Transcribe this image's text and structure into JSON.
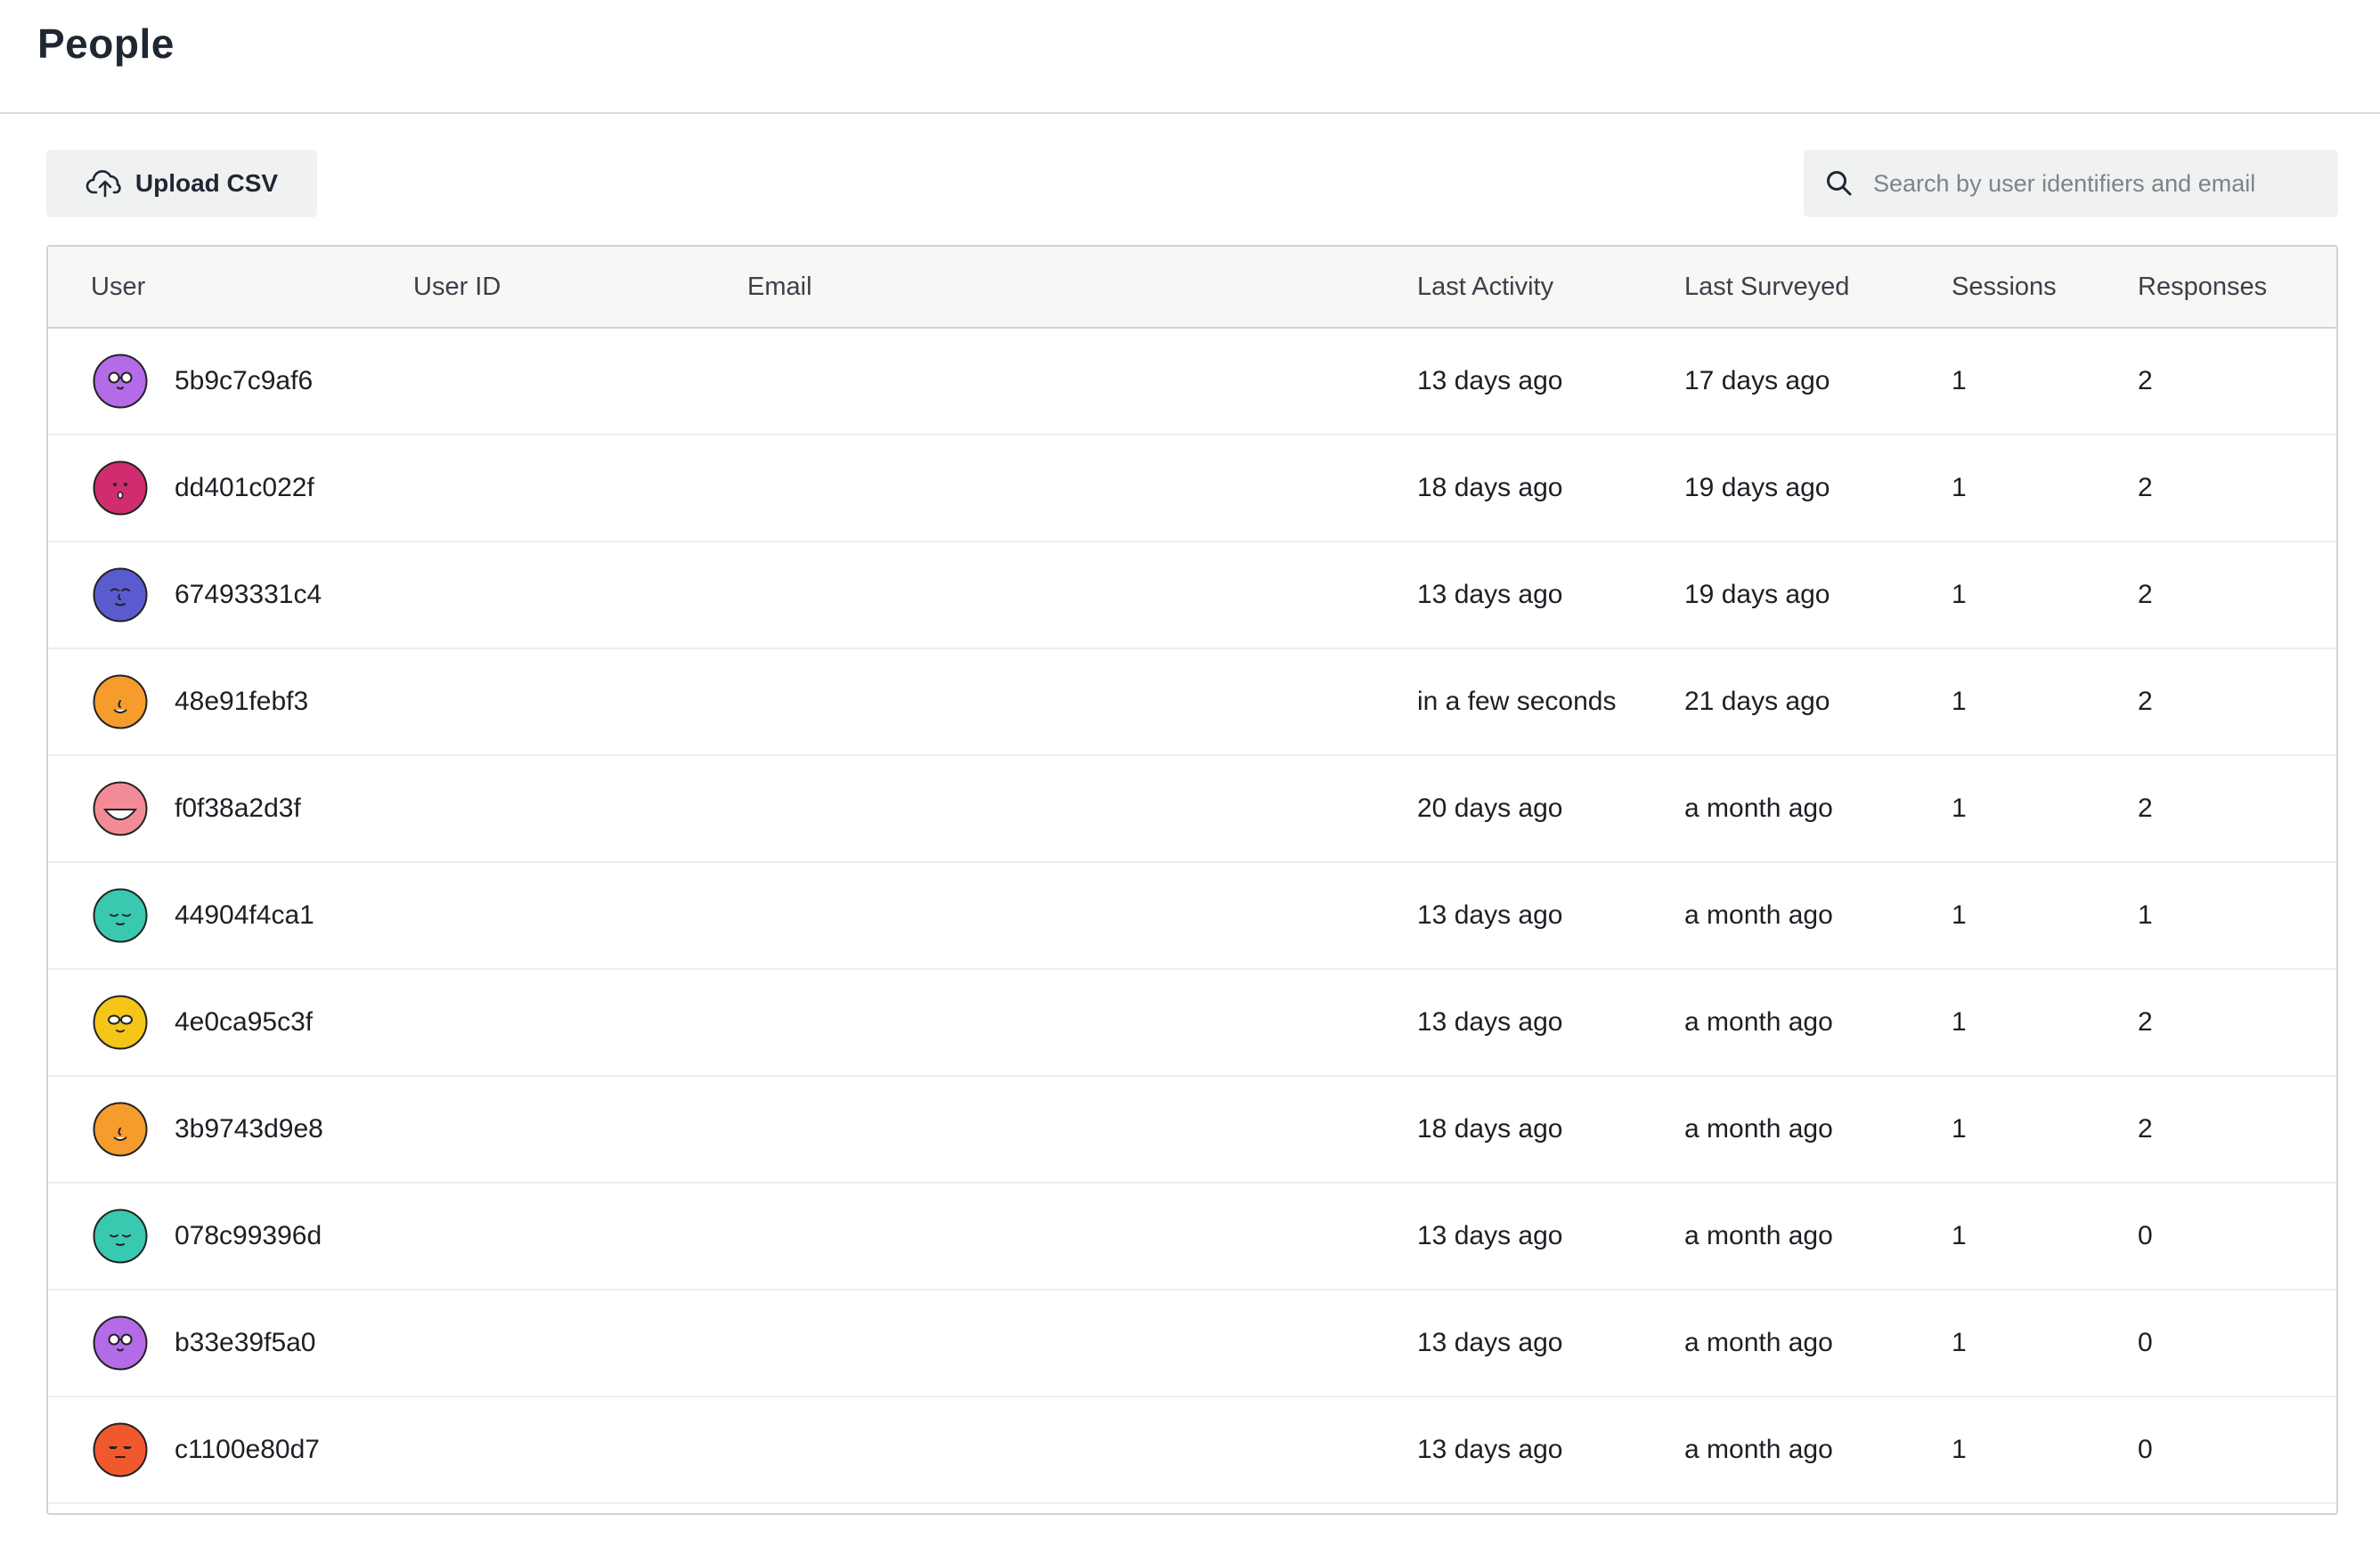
{
  "page": {
    "title": "People"
  },
  "toolbar": {
    "upload_label": "Upload CSV",
    "search_placeholder": "Search by user identifiers and email"
  },
  "table": {
    "columns": {
      "user": "User",
      "user_id": "User ID",
      "email": "Email",
      "last_activity": "Last Activity",
      "last_surveyed": "Last Surveyed",
      "sessions": "Sessions",
      "responses": "Responses"
    },
    "rows": [
      {
        "user": "5b9c7c9af6",
        "user_id": "",
        "email": "",
        "last_activity": "13 days ago",
        "last_surveyed": "17 days ago",
        "sessions": "1",
        "responses": "2",
        "avatar": {
          "icon": "glasses-face-icon",
          "color": "#b36be8"
        }
      },
      {
        "user": "dd401c022f",
        "user_id": "",
        "email": "",
        "last_activity": "18 days ago",
        "last_surveyed": "19 days ago",
        "sessions": "1",
        "responses": "2",
        "avatar": {
          "icon": "surprised-face-icon",
          "color": "#cf2d6e"
        }
      },
      {
        "user": "67493331c4",
        "user_id": "",
        "email": "",
        "last_activity": "13 days ago",
        "last_surveyed": "19 days ago",
        "sessions": "1",
        "responses": "2",
        "avatar": {
          "icon": "calm-face-icon",
          "color": "#5b5bd0"
        }
      },
      {
        "user": "48e91febf3",
        "user_id": "",
        "email": "",
        "last_activity": "in a few seconds",
        "last_surveyed": "21 days ago",
        "sessions": "1",
        "responses": "2",
        "avatar": {
          "icon": "smirk-face-icon",
          "color": "#f59c2c"
        }
      },
      {
        "user": "f0f38a2d3f",
        "user_id": "",
        "email": "",
        "last_activity": "20 days ago",
        "last_surveyed": "a month ago",
        "sessions": "1",
        "responses": "2",
        "avatar": {
          "icon": "grin-face-icon",
          "color": "#f28b96"
        }
      },
      {
        "user": "44904f4ca1",
        "user_id": "",
        "email": "",
        "last_activity": "13 days ago",
        "last_surveyed": "a month ago",
        "sessions": "1",
        "responses": "1",
        "avatar": {
          "icon": "sleepy-face-icon",
          "color": "#39c9b0"
        }
      },
      {
        "user": "4e0ca95c3f",
        "user_id": "",
        "email": "",
        "last_activity": "13 days ago",
        "last_surveyed": "a month ago",
        "sessions": "1",
        "responses": "2",
        "avatar": {
          "icon": "sunglasses-face-icon",
          "color": "#f5c518"
        }
      },
      {
        "user": "3b9743d9e8",
        "user_id": "",
        "email": "",
        "last_activity": "18 days ago",
        "last_surveyed": "a month ago",
        "sessions": "1",
        "responses": "2",
        "avatar": {
          "icon": "smirk-face-icon",
          "color": "#f59c2c"
        }
      },
      {
        "user": "078c99396d",
        "user_id": "",
        "email": "",
        "last_activity": "13 days ago",
        "last_surveyed": "a month ago",
        "sessions": "1",
        "responses": "0",
        "avatar": {
          "icon": "sleepy-face-icon",
          "color": "#39c9b0"
        }
      },
      {
        "user": "b33e39f5a0",
        "user_id": "",
        "email": "",
        "last_activity": "13 days ago",
        "last_surveyed": "a month ago",
        "sessions": "1",
        "responses": "0",
        "avatar": {
          "icon": "glasses-face-icon",
          "color": "#b36be8"
        }
      },
      {
        "user": "c1100e80d7",
        "user_id": "",
        "email": "",
        "last_activity": "13 days ago",
        "last_surveyed": "a month ago",
        "sessions": "1",
        "responses": "0",
        "avatar": {
          "icon": "cool-face-icon",
          "color": "#f2582e"
        }
      }
    ]
  }
}
